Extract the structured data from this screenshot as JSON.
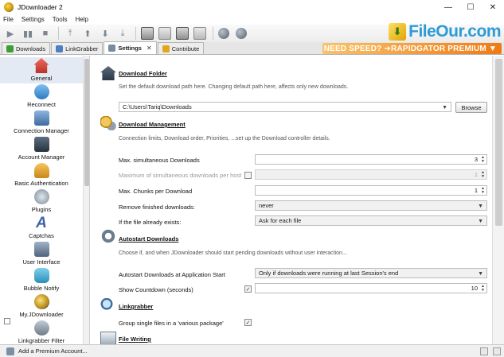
{
  "window": {
    "title": "JDownloader 2",
    "minimize": "—",
    "maximize": "☐",
    "close": "✕"
  },
  "menu": {
    "items": [
      "File",
      "Settings",
      "Tools",
      "Help"
    ]
  },
  "watermark": {
    "text": "FileOur.com"
  },
  "tabs": [
    {
      "label": "Downloads",
      "icon_color": "#3e9d34"
    },
    {
      "label": "LinkGrabber",
      "icon_color": "#4d7fc1"
    },
    {
      "label": "Settings",
      "icon_color": "#7b8b9e",
      "close": "✕"
    },
    {
      "label": "Contribute",
      "icon_color": "#e0a61d"
    }
  ],
  "banner": {
    "text": "NEED SPEED? ➔RAPIDGATOR PREMIUM ▼"
  },
  "sidebar": {
    "items": [
      {
        "label": "General",
        "icon": "house-icon",
        "color": "#d8473a"
      },
      {
        "label": "Reconnect",
        "icon": "reconnect-icon",
        "color": "#3f8fd4"
      },
      {
        "label": "Connection Manager",
        "icon": "network-icon",
        "color": "#4a7db3"
      },
      {
        "label": "Account Manager",
        "icon": "monitor-icon",
        "color": "#3a4b5c"
      },
      {
        "label": "Basic Authentication",
        "icon": "users-icon",
        "color": "#e5a42b"
      },
      {
        "label": "Plugins",
        "icon": "plugins-icon",
        "color": "#8d9aa8"
      },
      {
        "label": "Captchas",
        "icon": "captcha-icon",
        "color": "#4b6ea8"
      },
      {
        "label": "User Interface",
        "icon": "ui-icon",
        "color": "#5a6f87"
      },
      {
        "label": "Bubble Notify",
        "icon": "bubble-icon",
        "color": "#3ea2c8"
      },
      {
        "label": "My.JDownloader",
        "icon": "myjd-icon",
        "color": "#c09a22"
      },
      {
        "label": "Linkgrabber Filter",
        "icon": "filter-icon",
        "color": "#7e8a96"
      }
    ]
  },
  "sections": {
    "download_folder": {
      "title": "Download Folder",
      "desc": "Set the default download path here. Changing default path here, affects only new downloads.",
      "path": "C:\\Users\\Tariq\\Downloads",
      "browse": "Browse"
    },
    "download_management": {
      "title": "Download Management",
      "desc": "Connection limits, Download order, Priorities, ...set up the Download controller details.",
      "max_sim_label": "Max. simultaneous Downloads",
      "max_sim_value": "3",
      "max_per_host_label": "Maximum of simultaneous downloads per host",
      "max_per_host_value": "1",
      "max_chunks_label": "Max. Chunks per Download",
      "max_chunks_value": "1",
      "remove_finished_label": "Remove finished downloads:",
      "remove_finished_value": "never",
      "file_exists_label": "If the file already exists:",
      "file_exists_value": "Ask for each file"
    },
    "autostart": {
      "title": "Autostart Downloads",
      "desc": "Choose if, and when JDownloader should start pending downloads without user interaction...",
      "at_start_label": "Autostart Downloads at Application Start",
      "at_start_value": "Only if downloads were running at last Session's end",
      "countdown_label": "Show Countdown (seconds)",
      "countdown_value": "10"
    },
    "linkgrabber": {
      "title": "Linkgrabber",
      "group_label": "Group single files in a 'various package'"
    },
    "file_writing": {
      "title": "File Writing"
    }
  },
  "status": {
    "add_account": "Add a Premium Account..."
  }
}
